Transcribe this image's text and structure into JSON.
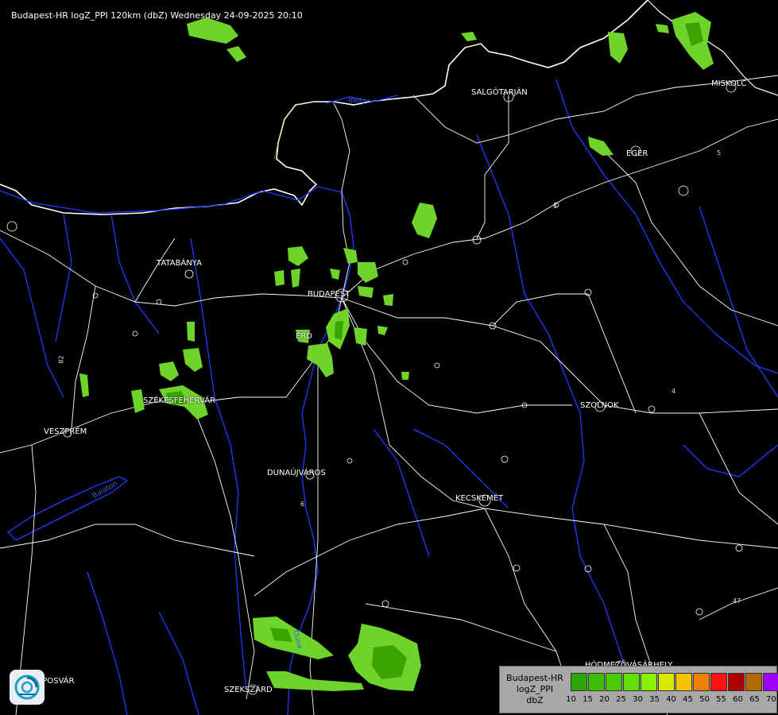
{
  "header": {
    "title": "Budapest-HR logZ_PPI 120km (dbZ) Wednesday 24-09-2025 20:10"
  },
  "cities": [
    {
      "name": "SALGÓTARJÁN"
    },
    {
      "name": "EGER"
    },
    {
      "name": "TATABÁNYA"
    },
    {
      "name": "BUDAPEST"
    },
    {
      "name": "ÉRD"
    },
    {
      "name": "SZÉKESFEHÉRVÁR"
    },
    {
      "name": "VESZPRÉM"
    },
    {
      "name": "SZOLNOK"
    },
    {
      "name": "DUNAÚJVÁROS"
    },
    {
      "name": "KECSKEMÉT"
    },
    {
      "name": "HÓDMEZŐVÁSÁRHELY"
    },
    {
      "name": "SZEKSZÁRD"
    },
    {
      "name": "MISKOLC"
    },
    {
      "name": "KAPOSVÁR"
    }
  ],
  "rivers": {
    "danube_north": "Ipoly",
    "danube_south": "Duna",
    "balaton": "Balaton"
  },
  "roads": [
    "82",
    "3",
    "4",
    "5",
    "47",
    "6"
  ],
  "legend": {
    "title_line1": "Budapest-HR",
    "title_line2": "logZ_PPI",
    "title_line3": "dbZ",
    "steps": [
      {
        "value": "10",
        "color": "#2ea800"
      },
      {
        "value": "15",
        "color": "#3cbf00"
      },
      {
        "value": "20",
        "color": "#4ccc00"
      },
      {
        "value": "25",
        "color": "#5fe000"
      },
      {
        "value": "30",
        "color": "#88f000"
      },
      {
        "value": "35",
        "color": "#d8e800"
      },
      {
        "value": "40",
        "color": "#f5c400"
      },
      {
        "value": "45",
        "color": "#f08000"
      },
      {
        "value": "50",
        "color": "#ff1010"
      },
      {
        "value": "55",
        "color": "#b00000"
      },
      {
        "value": "60",
        "color": "#b06a00"
      },
      {
        "value": "65",
        "color": "#a000ff"
      },
      {
        "value": "70",
        "color": "#a8a8ff"
      }
    ],
    "end_label": "70"
  },
  "colors": {
    "background": "#000000",
    "border_white": "#ffffff",
    "river": "#1e3cff",
    "echo_light": "#6fd42a",
    "echo_dark": "#3aa400"
  }
}
